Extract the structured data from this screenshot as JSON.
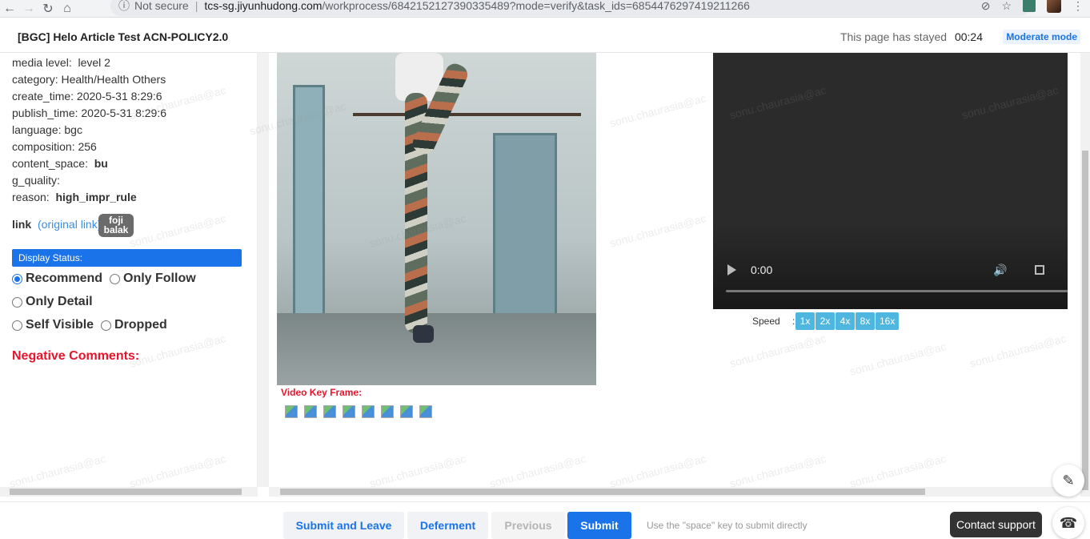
{
  "browser": {
    "security_label": "Not secure",
    "url_host": "tcs-sg.jiyunhudong.com",
    "url_path": "/workprocess/6842152127390335489?mode=verify&task_ids=6854476297419211266"
  },
  "header": {
    "title": "[BGC] Helo Article Test ACN-POLICY2.0",
    "stayed_label": "This page has stayed",
    "stayed_time": "00:24",
    "mode_label": "Moderate mode"
  },
  "meta": {
    "media_level_label": "media level:",
    "media_level_value": "level 2",
    "category": "category: Health/Health Others",
    "create_time": "create_time: 2020-5-31 8:29:6",
    "publish_time": "publish_time: 2020-5-31 8:29:6",
    "language": "language: bgc",
    "composition": "composition: 256",
    "content_space_label": "content_space:",
    "content_space_value": "bu",
    "g_quality": "g_quality:",
    "reason_label": "reason:",
    "reason_value": "high_impr_rule"
  },
  "link": {
    "label": "link",
    "original": "(original link)",
    "tag": "foji balak"
  },
  "display_status": {
    "title": "Display Status:",
    "options": [
      "Recommend",
      "Only Follow",
      "Only Detail",
      "Self Visible",
      "Dropped"
    ],
    "selected": "Recommend"
  },
  "negative_comments_label": "Negative Comments:",
  "video_key_frame_label": "Video Key Frame:",
  "video": {
    "time": "0:00",
    "speed_label": "Speed",
    "speed_colon": ":",
    "speeds": [
      "1x",
      "2x",
      "4x",
      "8x",
      "16x"
    ]
  },
  "watermark_text": "sonu.chaurasia@ac",
  "footer": {
    "submit_leave": "Submit and Leave",
    "deferment": "Deferment",
    "previous": "Previous",
    "submit": "Submit",
    "hint": "Use the \"space\" key to submit directly",
    "contact_support": "Contact support"
  },
  "icons": {
    "back": "arrow-left-icon",
    "forward": "arrow-right-icon",
    "reload": "reload-icon",
    "home": "home-icon",
    "edit": "pencil-icon",
    "support": "headset-icon"
  },
  "colors": {
    "primary": "#1a73e8",
    "danger": "#e8142b",
    "speed_button": "#4fb7df"
  }
}
